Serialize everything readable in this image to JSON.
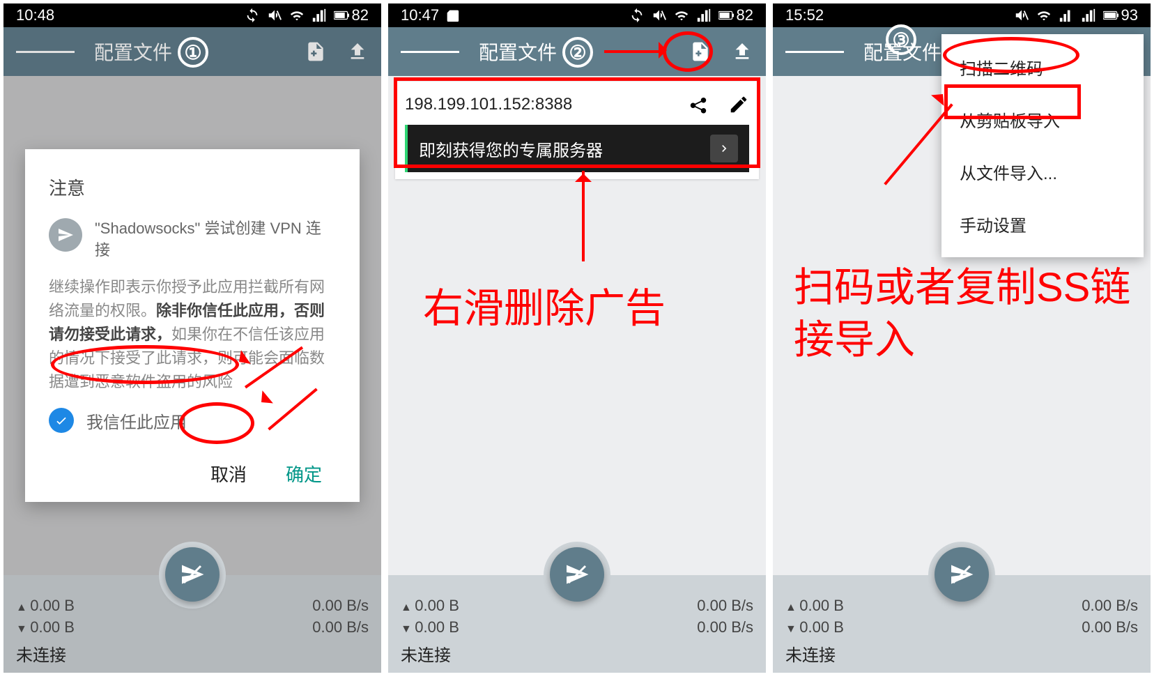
{
  "step_badges": [
    "①",
    "②",
    "③"
  ],
  "appbar": {
    "title": "配置文件"
  },
  "statusbar": {
    "s1": {
      "time": "10:48",
      "battery": "82"
    },
    "s2": {
      "time": "10:47",
      "battery": "82"
    },
    "s3": {
      "time": "15:52",
      "battery": "93"
    }
  },
  "dialog": {
    "title": "注意",
    "line1": "\"Shadowsocks\" 尝试创建 VPN 连接",
    "para_pre": "继续操作即表示你授予此应用拦截所有网络流量的权限。",
    "para_bold": "除非你信任此应用，否则请勿接受此请求，",
    "para_post": "如果你在不信任该应用的情况下接受了此请求，则可能会面临数据遭到恶意软件盗用的风险",
    "trust": "我信任此应用",
    "cancel": "取消",
    "ok": "确定"
  },
  "card": {
    "server": "198.199.101.152:8388",
    "ad": "即刻获得您的专属服务器"
  },
  "popup": {
    "scan": "扫描二维码",
    "clipboard": "从剪贴板导入",
    "file": "从文件导入...",
    "manual": "手动设置"
  },
  "footer": {
    "up": "0.00 B",
    "dn": "0.00 B",
    "up_rate": "0.00 B/s",
    "dn_rate": "0.00 B/s",
    "status": "未连接"
  },
  "anno": {
    "s2": "右滑删除广告",
    "s3": "扫码或者复制SS链接导入"
  }
}
